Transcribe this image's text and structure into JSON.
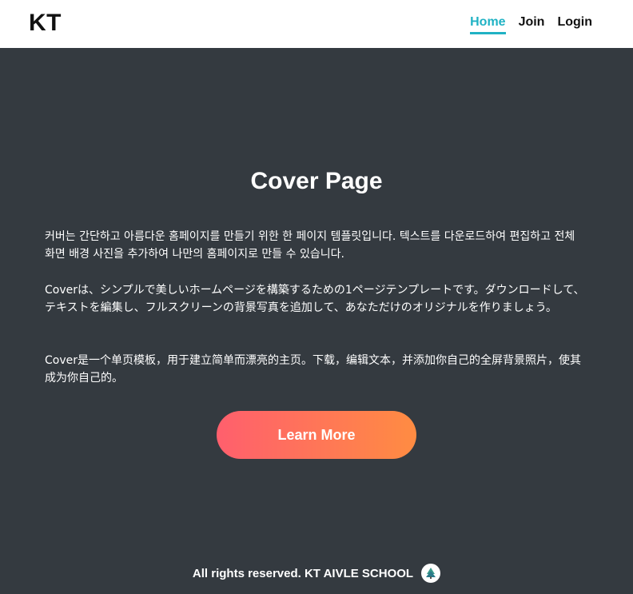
{
  "header": {
    "brand": "KT",
    "nav": [
      {
        "label": "Home",
        "active": true
      },
      {
        "label": "Join",
        "active": false
      },
      {
        "label": "Login",
        "active": false
      }
    ]
  },
  "main": {
    "title": "Cover Page",
    "paragraphs": [
      "커버는 간단하고 아름다운 홈페이지를 만들기 위한 한 페이지 템플릿입니다. 텍스트를 다운로드하여 편집하고 전체 화면 배경 사진을 추가하여 나만의 홈페이지로 만들 수 있습니다.",
      "Coverは、シンプルで美しいホームページを構築するための1ページテンプレートです。ダウンロードして、テキストを編集し、フルスクリーンの背景写真を追加して、あなただけのオリジナルを作りましょう。",
      "Cover是一个单页模板，用于建立简单而漂亮的主页。下载，编辑文本，并添加你自己的全屏背景照片，使其成为你自己的。"
    ],
    "cta_label": "Learn More"
  },
  "footer": {
    "text": "All rights reserved. KT AIVLE SCHOOL",
    "icon": "tree-logo-icon"
  },
  "colors": {
    "header_bg": "#ffffff",
    "page_bg": "#343a40",
    "nav_active": "#20b2c4",
    "cta_gradient_start": "#ff5f6d",
    "cta_gradient_end": "#ff8c42"
  }
}
